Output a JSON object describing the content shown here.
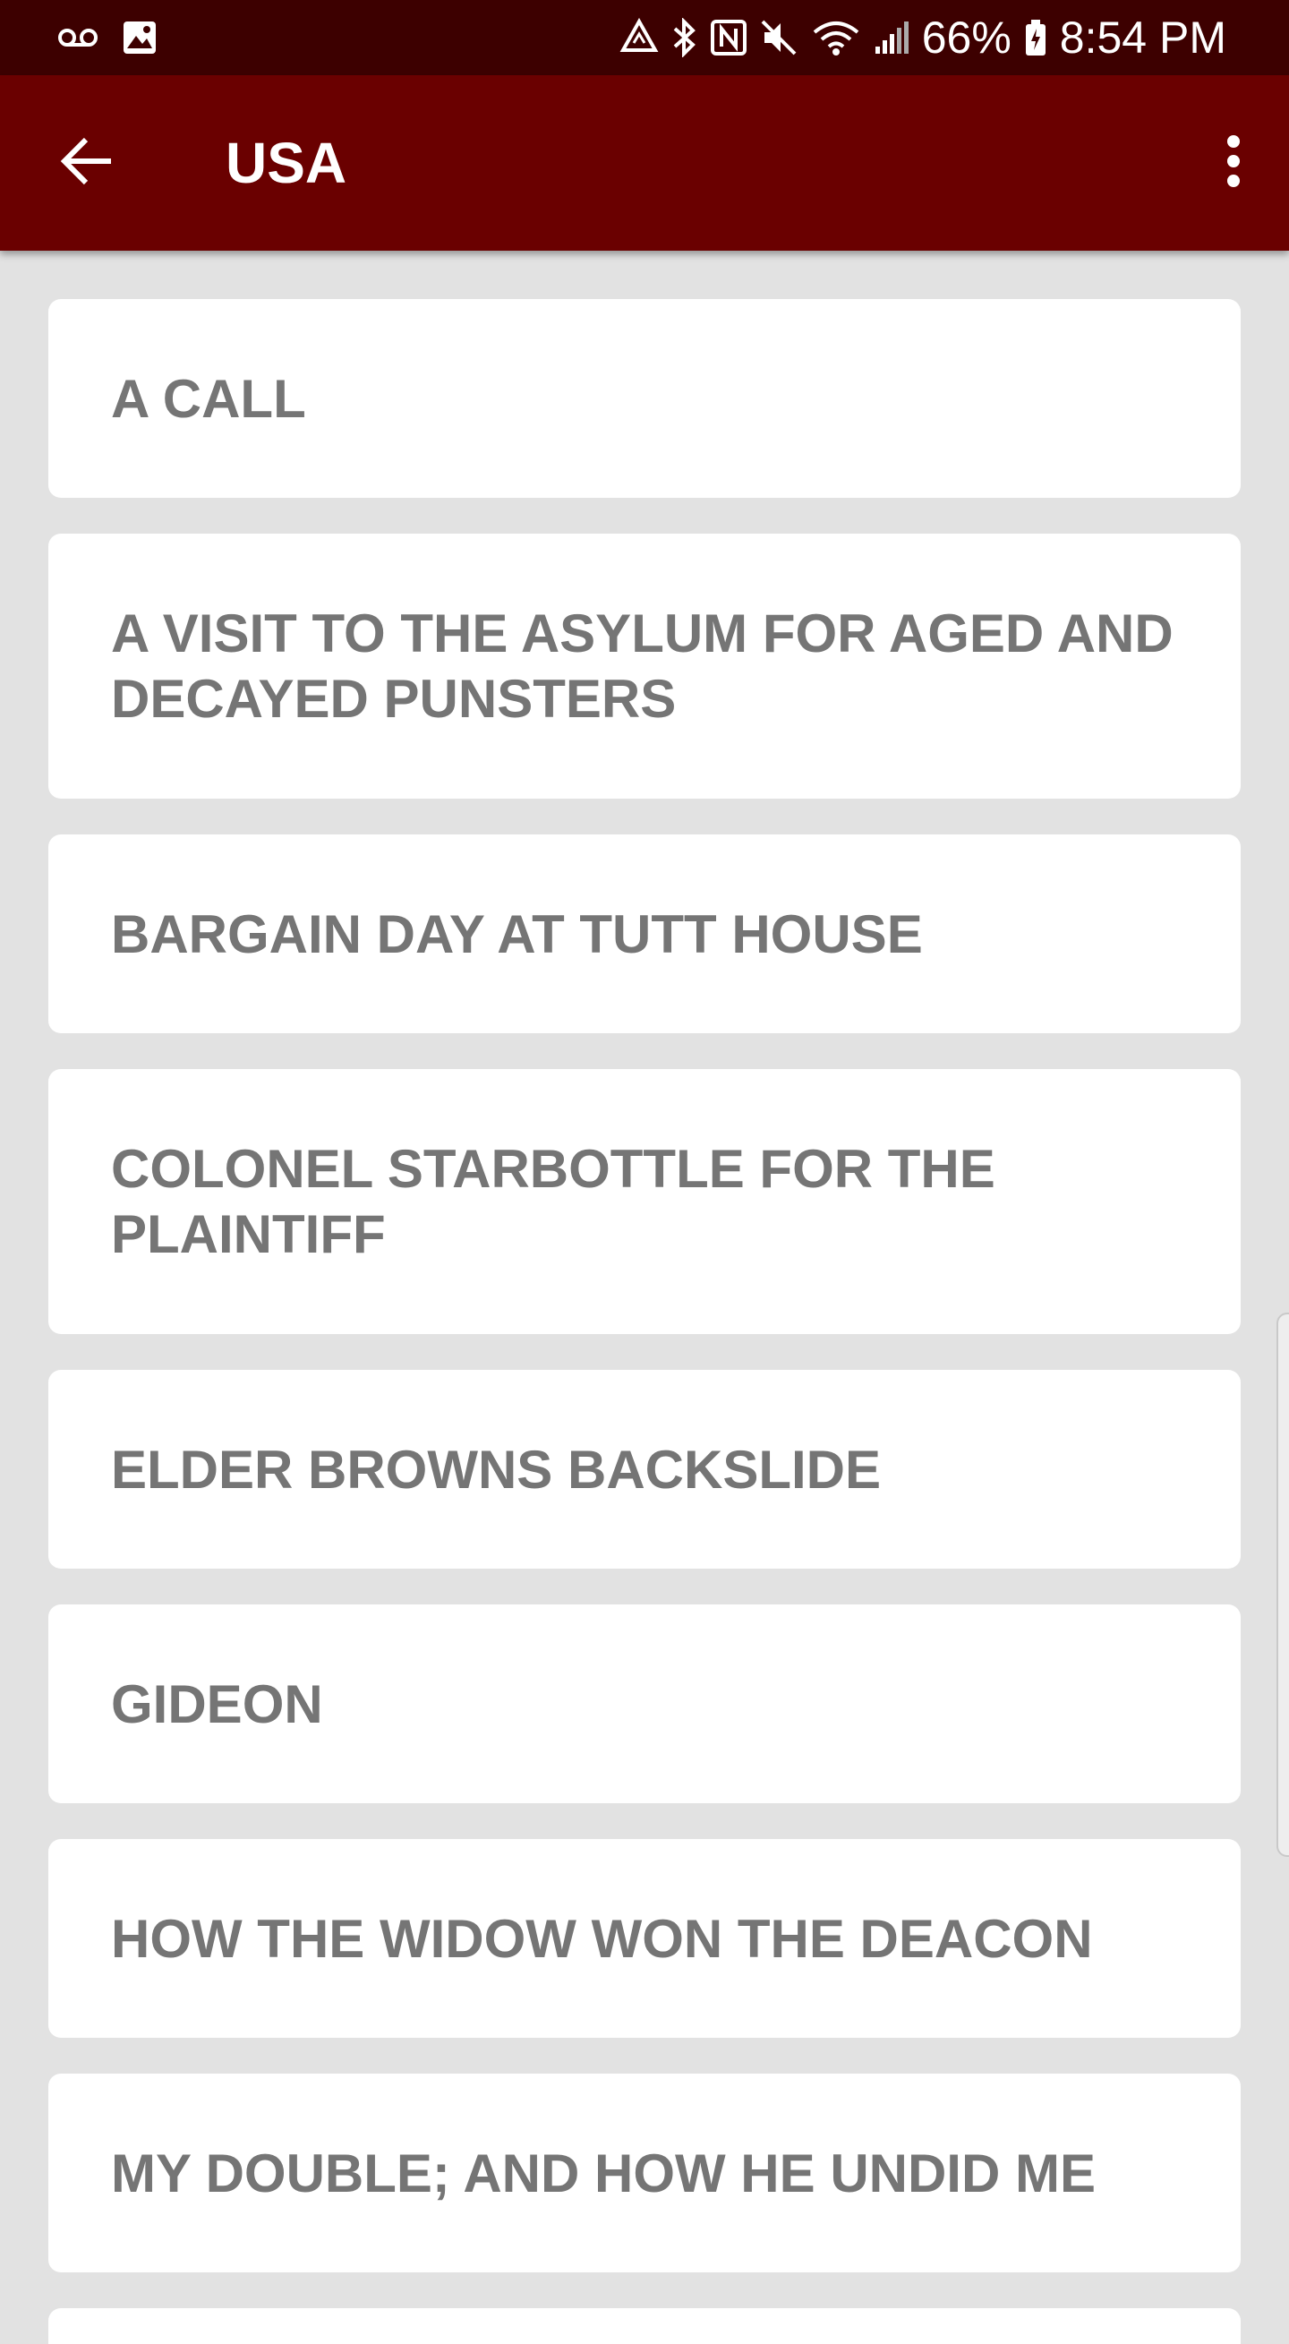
{
  "status_bar": {
    "battery": "66%",
    "time": "8:54 PM",
    "icons_left": [
      "voicemail-icon",
      "image-icon"
    ],
    "icons_right": [
      "data-saver-icon",
      "bluetooth-icon",
      "nfc-icon",
      "mute-icon",
      "wifi-icon",
      "signal-icon",
      "battery-icon"
    ]
  },
  "app_bar": {
    "title": "USA",
    "back_icon": "arrow-back-icon",
    "menu_icon": "more-vert-icon"
  },
  "colors": {
    "status_bar": "#3d0000",
    "app_bar": "#6a0000",
    "background": "#e2e2e2",
    "card": "#ffffff",
    "card_text": "#757575"
  },
  "stories": [
    {
      "title": "A CALL"
    },
    {
      "title": "A VISIT TO THE ASYLUM FOR AGED AND DECAYED PUNSTERS"
    },
    {
      "title": "BARGAIN DAY AT TUTT HOUSE"
    },
    {
      "title": "COLONEL STARBOTTLE FOR THE PLAINTIFF"
    },
    {
      "title": "ELDER BROWNS BACKSLIDE"
    },
    {
      "title": "GIDEON"
    },
    {
      "title": "HOW THE WIDOW WON THE DEACON"
    },
    {
      "title": "MY DOUBLE; AND HOW HE UNDID ME"
    },
    {
      "title": ""
    }
  ]
}
